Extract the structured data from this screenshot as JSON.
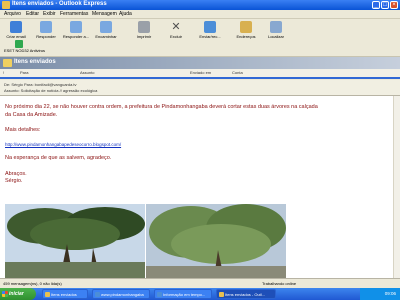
{
  "window": {
    "title": "Itens enviados - Outlook Express"
  },
  "menu": [
    "Arquivo",
    "Editar",
    "Exibir",
    "Ferramentas",
    "Mensagem",
    "Ajuda"
  ],
  "toolbar": [
    {
      "label": "Criar email",
      "icon": "new-mail-icon",
      "color": "#3F7FD8"
    },
    {
      "label": "Responder",
      "icon": "reply-icon",
      "color": "#7AA8E0"
    },
    {
      "label": "Responder a...",
      "icon": "reply-all-icon",
      "color": "#7AA8E0"
    },
    {
      "label": "Encaminhar",
      "icon": "forward-icon",
      "color": "#7AA8E0"
    },
    {
      "label": "Imprimir",
      "icon": "print-icon",
      "color": "#9AA0A8"
    },
    {
      "label": "Excluir",
      "icon": "delete-icon",
      "color": "#606060"
    },
    {
      "label": "Enviar/rec...",
      "icon": "send-receive-icon",
      "color": "#4C8ED8"
    },
    {
      "label": "Endereços",
      "icon": "address-book-icon",
      "color": "#D8B050"
    },
    {
      "label": "Localizar",
      "icon": "find-icon",
      "color": "#88A8D0"
    }
  ],
  "toolbar_extra": {
    "label": "ESET NOD32 Antivirus",
    "icon": "antivirus-icon",
    "color": "#2FA84F"
  },
  "folder": {
    "title": "Itens enviados"
  },
  "columns": [
    "!",
    "Para",
    "Assunto",
    "Enviado em",
    "Conta"
  ],
  "header": {
    "line1": "De: Sérgio   Para: bonifacil@vanguarda.tv",
    "line2": "Assunto: Solicitação de notícia // agressão ecológica"
  },
  "message": {
    "p1a": "No próximo dia 22, se não houver contra ordem, a prefeitura de Pindamonhangaba deverá cortar estas duas árvores na calçada",
    "p1b": "da Casa da Amizade.",
    "details": "Mais detalhes:",
    "link": "http://www.pindamonhangabapedeseocorro.blogspot.com/",
    "hope": "Na esperança de que as salvem, agradeço.",
    "closing": "Abraços.",
    "signature": "Sérgio."
  },
  "status": {
    "count": "459 mensagem(ns), 0 não lida(s)",
    "mode": "Trabalhando online"
  },
  "taskbar": {
    "start": "iniciar",
    "tasks": [
      "Itens enviados",
      "www.pindamonhangaba",
      "Informação em tempo...",
      "Itens enviados - Outl..."
    ],
    "clock": "09:06"
  }
}
